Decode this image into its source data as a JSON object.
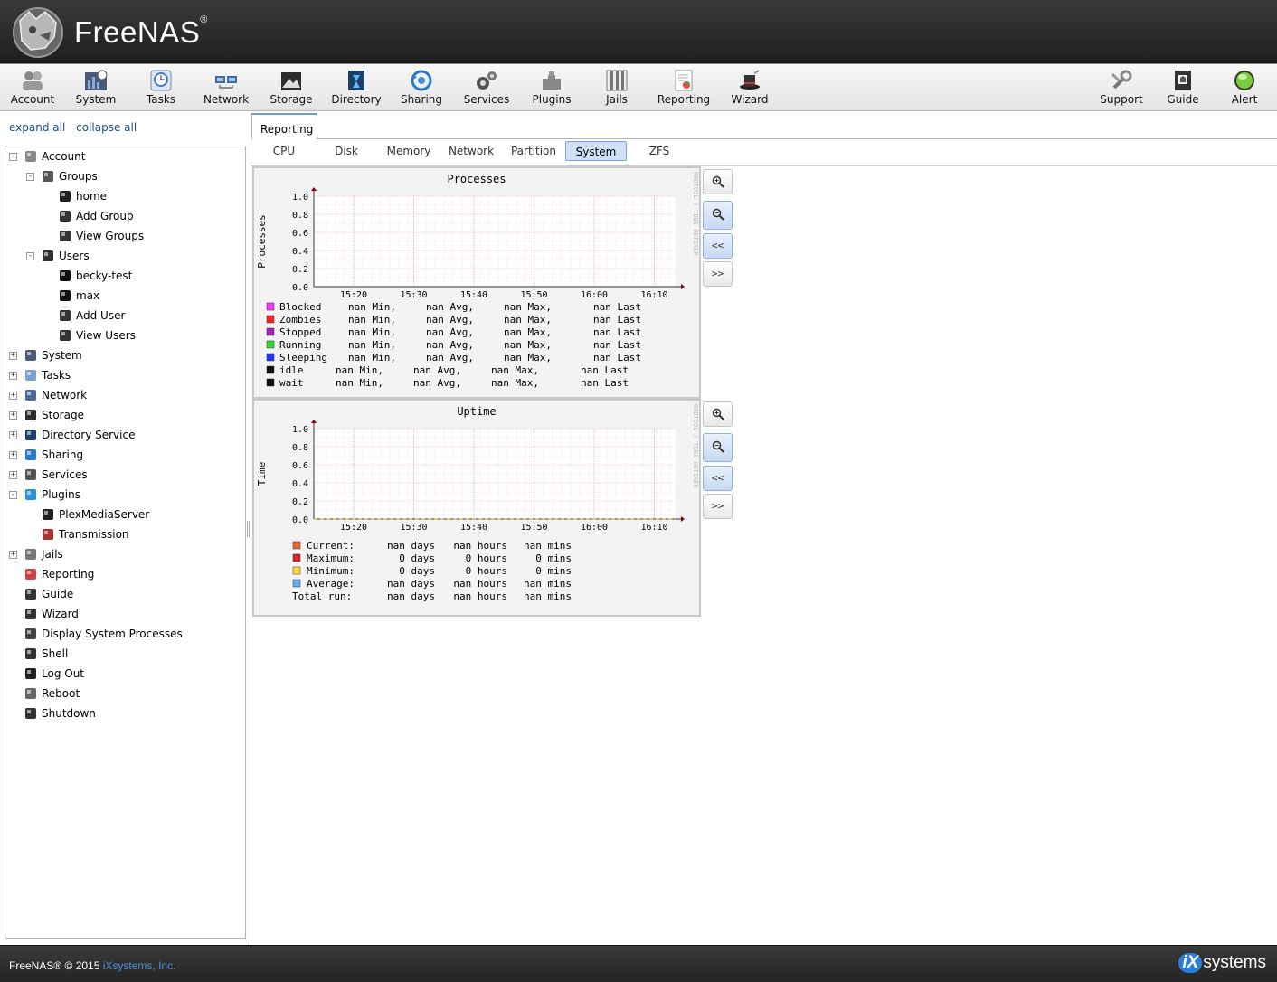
{
  "header": {
    "brand": "FreeNAS",
    "registered": "®"
  },
  "toolbar": {
    "left": [
      {
        "label": "Account",
        "icon": "account-icon"
      },
      {
        "label": "System",
        "icon": "system-icon"
      },
      {
        "label": "Tasks",
        "icon": "tasks-icon"
      },
      {
        "label": "Network",
        "icon": "network-icon"
      },
      {
        "label": "Storage",
        "icon": "storage-icon"
      },
      {
        "label": "Directory",
        "icon": "directory-icon"
      },
      {
        "label": "Sharing",
        "icon": "sharing-icon"
      },
      {
        "label": "Services",
        "icon": "services-icon"
      },
      {
        "label": "Plugins",
        "icon": "plugins-icon"
      },
      {
        "label": "Jails",
        "icon": "jails-icon"
      },
      {
        "label": "Reporting",
        "icon": "reporting-icon"
      },
      {
        "label": "Wizard",
        "icon": "wizard-icon"
      }
    ],
    "right": [
      {
        "label": "Support",
        "icon": "support-icon"
      },
      {
        "label": "Guide",
        "icon": "guide-icon"
      },
      {
        "label": "Alert",
        "icon": "alert-icon",
        "color": "#7ac943"
      }
    ]
  },
  "sidebar": {
    "expand_all": "expand all",
    "collapse_all": "collapse all",
    "tree": [
      {
        "label": "Account",
        "level": 0,
        "expander": "-",
        "icon": "account-icon"
      },
      {
        "label": "Groups",
        "level": 1,
        "expander": "-",
        "icon": "groups-icon"
      },
      {
        "label": "home",
        "level": 2,
        "expander": "",
        "icon": "group-icon"
      },
      {
        "label": "Add Group",
        "level": 2,
        "expander": "",
        "icon": "add-group-icon"
      },
      {
        "label": "View Groups",
        "level": 2,
        "expander": "",
        "icon": "view-groups-icon"
      },
      {
        "label": "Users",
        "level": 1,
        "expander": "-",
        "icon": "users-icon"
      },
      {
        "label": "becky-test",
        "level": 2,
        "expander": "",
        "icon": "user-icon"
      },
      {
        "label": "max",
        "level": 2,
        "expander": "",
        "icon": "user-icon"
      },
      {
        "label": "Add User",
        "level": 2,
        "expander": "",
        "icon": "add-user-icon"
      },
      {
        "label": "View Users",
        "level": 2,
        "expander": "",
        "icon": "view-users-icon"
      },
      {
        "label": "System",
        "level": 0,
        "expander": "+",
        "icon": "system-icon"
      },
      {
        "label": "Tasks",
        "level": 0,
        "expander": "+",
        "icon": "tasks-icon"
      },
      {
        "label": "Network",
        "level": 0,
        "expander": "+",
        "icon": "network-icon"
      },
      {
        "label": "Storage",
        "level": 0,
        "expander": "+",
        "icon": "storage-icon"
      },
      {
        "label": "Directory Service",
        "level": 0,
        "expander": "+",
        "icon": "directory-icon"
      },
      {
        "label": "Sharing",
        "level": 0,
        "expander": "+",
        "icon": "sharing-icon"
      },
      {
        "label": "Services",
        "level": 0,
        "expander": "+",
        "icon": "services-icon"
      },
      {
        "label": "Plugins",
        "level": 0,
        "expander": "-",
        "icon": "plugins-icon"
      },
      {
        "label": "PlexMediaServer",
        "level": 1.5,
        "expander": "",
        "icon": "plex-icon"
      },
      {
        "label": "Transmission",
        "level": 1.5,
        "expander": "",
        "icon": "transmission-icon"
      },
      {
        "label": "Jails",
        "level": 0,
        "expander": "+",
        "icon": "jails-icon"
      },
      {
        "label": "Reporting",
        "level": 0,
        "expander": "",
        "icon": "reporting-icon"
      },
      {
        "label": "Guide",
        "level": 0,
        "expander": "",
        "icon": "guide-icon"
      },
      {
        "label": "Wizard",
        "level": 0,
        "expander": "",
        "icon": "wizard-icon"
      },
      {
        "label": "Display System Processes",
        "level": 0,
        "expander": "",
        "icon": "processes-icon"
      },
      {
        "label": "Shell",
        "level": 0,
        "expander": "",
        "icon": "shell-icon"
      },
      {
        "label": "Log Out",
        "level": 0,
        "expander": "",
        "icon": "logout-icon"
      },
      {
        "label": "Reboot",
        "level": 0,
        "expander": "",
        "icon": "reboot-icon"
      },
      {
        "label": "Shutdown",
        "level": 0,
        "expander": "",
        "icon": "shutdown-icon"
      }
    ]
  },
  "main": {
    "tab": "Reporting",
    "subtabs": [
      "CPU",
      "Disk",
      "Memory",
      "Network",
      "Partition",
      "System",
      "ZFS"
    ],
    "active_subtab": "System",
    "graph_buttons": {
      "zoom_in": "zoom-in-icon",
      "zoom_out": "zoom-out-icon",
      "back": "<<",
      "forward": ">>"
    },
    "watermark": "RRDTOOL / TOBI OETIKER"
  },
  "chart_data": [
    {
      "type": "line",
      "title": "Processes",
      "ylabel": "Processes",
      "xlabel": "",
      "x": [
        "15:20",
        "15:30",
        "15:40",
        "15:50",
        "16:00",
        "16:10"
      ],
      "yticks": [
        "0.0",
        "0.2",
        "0.4",
        "0.6",
        "0.8",
        "1.0"
      ],
      "ylim": [
        0,
        1
      ],
      "grid": true,
      "legend_position": "bottom",
      "legend": [
        {
          "name": "Blocked",
          "color": "#ff33ff",
          "min": "nan Min,",
          "avg": "nan Avg,",
          "max": "nan Max,",
          "last": "nan Last"
        },
        {
          "name": "Zombies",
          "color": "#ff2222",
          "min": "nan Min,",
          "avg": "nan Avg,",
          "max": "nan Max,",
          "last": "nan Last"
        },
        {
          "name": "Stopped",
          "color": "#aa22bb",
          "min": "nan Min,",
          "avg": "nan Avg,",
          "max": "nan Max,",
          "last": "nan Last"
        },
        {
          "name": "Running",
          "color": "#33dd33",
          "min": "nan Min,",
          "avg": "nan Avg,",
          "max": "nan Max,",
          "last": "nan Last"
        },
        {
          "name": "Sleeping",
          "color": "#2233ff",
          "min": "nan Min,",
          "avg": "nan Avg,",
          "max": "nan Max,",
          "last": "nan Last"
        },
        {
          "name": "idle",
          "color": "#111111",
          "min": "nan Min,",
          "avg": "nan Avg,",
          "max": "nan Max,",
          "last": "nan Last"
        },
        {
          "name": "wait",
          "color": "#111111",
          "min": "nan Min,",
          "avg": "nan Avg,",
          "max": "nan Max,",
          "last": "nan Last"
        }
      ],
      "series": []
    },
    {
      "type": "line",
      "title": "Uptime",
      "ylabel": "Time",
      "xlabel": "",
      "x": [
        "15:20",
        "15:30",
        "15:40",
        "15:50",
        "16:00",
        "16:10"
      ],
      "yticks": [
        "0.0",
        "0.2",
        "0.4",
        "0.6",
        "0.8",
        "1.0"
      ],
      "ylim": [
        0,
        1
      ],
      "grid": true,
      "legend_position": "bottom",
      "legend": [
        {
          "name": "Current:",
          "color": "#ee6633",
          "days": "nan days",
          "hours": "nan hours",
          "mins": "nan mins"
        },
        {
          "name": "Maximum:",
          "color": "#dd2233",
          "days": "0 days",
          "hours": "0 hours",
          "mins": "0 mins"
        },
        {
          "name": "Minimum:",
          "color": "#ffdd33",
          "days": "0 days",
          "hours": "0 hours",
          "mins": "0 mins"
        },
        {
          "name": "Average:",
          "color": "#66aaee",
          "days": "nan days",
          "hours": "nan hours",
          "mins": "nan mins"
        },
        {
          "name": "Total run:",
          "color": "",
          "days": "nan days",
          "hours": "nan hours",
          "mins": "nan mins"
        }
      ],
      "series": [
        {
          "name": "Maximum:",
          "values": [
            0,
            0,
            0,
            0,
            0,
            0
          ]
        }
      ]
    }
  ],
  "footer": {
    "copyright": "FreeNAS® © 2015",
    "company": "iXsystems, Inc.",
    "logo_ix": "iX",
    "logo_text": "systems"
  }
}
